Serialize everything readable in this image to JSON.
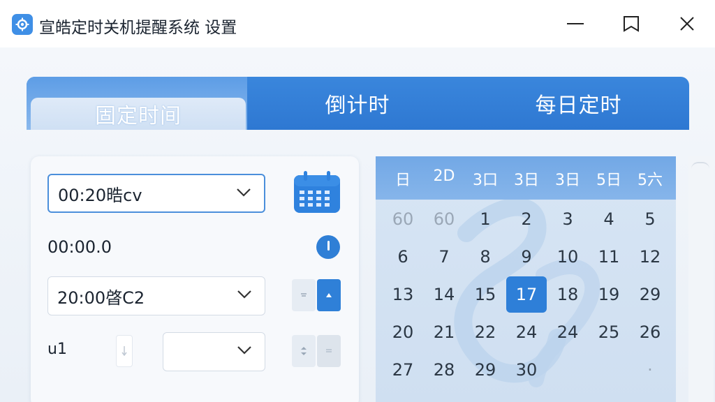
{
  "window": {
    "title": "宣皓定时关机提醒系统 设置",
    "icon": "gear-icon"
  },
  "tabs": [
    {
      "label": "固定时间",
      "active": true
    },
    {
      "label": "倒计时",
      "active": false
    },
    {
      "label": "每日定时",
      "active": false
    }
  ],
  "form": {
    "time_select_value": "00:20晧cv",
    "time_display": "00:00.0",
    "second_select_value": "20:00晵C2",
    "unit_label": "u1",
    "third_select_value": ""
  },
  "calendar": {
    "weekdays": [
      "日",
      "2D",
      "3口",
      "3日",
      "3日",
      "5日",
      "5六"
    ],
    "rows": [
      [
        {
          "d": "60",
          "m": true
        },
        {
          "d": "60",
          "m": true
        },
        {
          "d": "1"
        },
        {
          "d": "2"
        },
        {
          "d": "3"
        },
        {
          "d": "4"
        },
        {
          "d": "5"
        }
      ],
      [
        {
          "d": "6"
        },
        {
          "d": "7"
        },
        {
          "d": "8"
        },
        {
          "d": "9"
        },
        {
          "d": "10"
        },
        {
          "d": "11"
        },
        {
          "d": "12"
        }
      ],
      [
        {
          "d": "13"
        },
        {
          "d": "14"
        },
        {
          "d": "15"
        },
        {
          "d": "17",
          "today": true
        },
        {
          "d": "18"
        },
        {
          "d": "19"
        },
        {
          "d": "29"
        }
      ],
      [
        {
          "d": "20"
        },
        {
          "d": "21"
        },
        {
          "d": "22"
        },
        {
          "d": "24"
        },
        {
          "d": "24"
        },
        {
          "d": "25"
        },
        {
          "d": "26"
        }
      ],
      [
        {
          "d": "27"
        },
        {
          "d": "28"
        },
        {
          "d": "29"
        },
        {
          "d": "30"
        },
        {
          "d": ""
        },
        {
          "d": ""
        },
        {
          "d": "·",
          "m": true
        }
      ]
    ]
  },
  "colors": {
    "accent": "#2e7fd8",
    "tab_bar": "#3a86dc",
    "today": "#2e7fd8"
  }
}
